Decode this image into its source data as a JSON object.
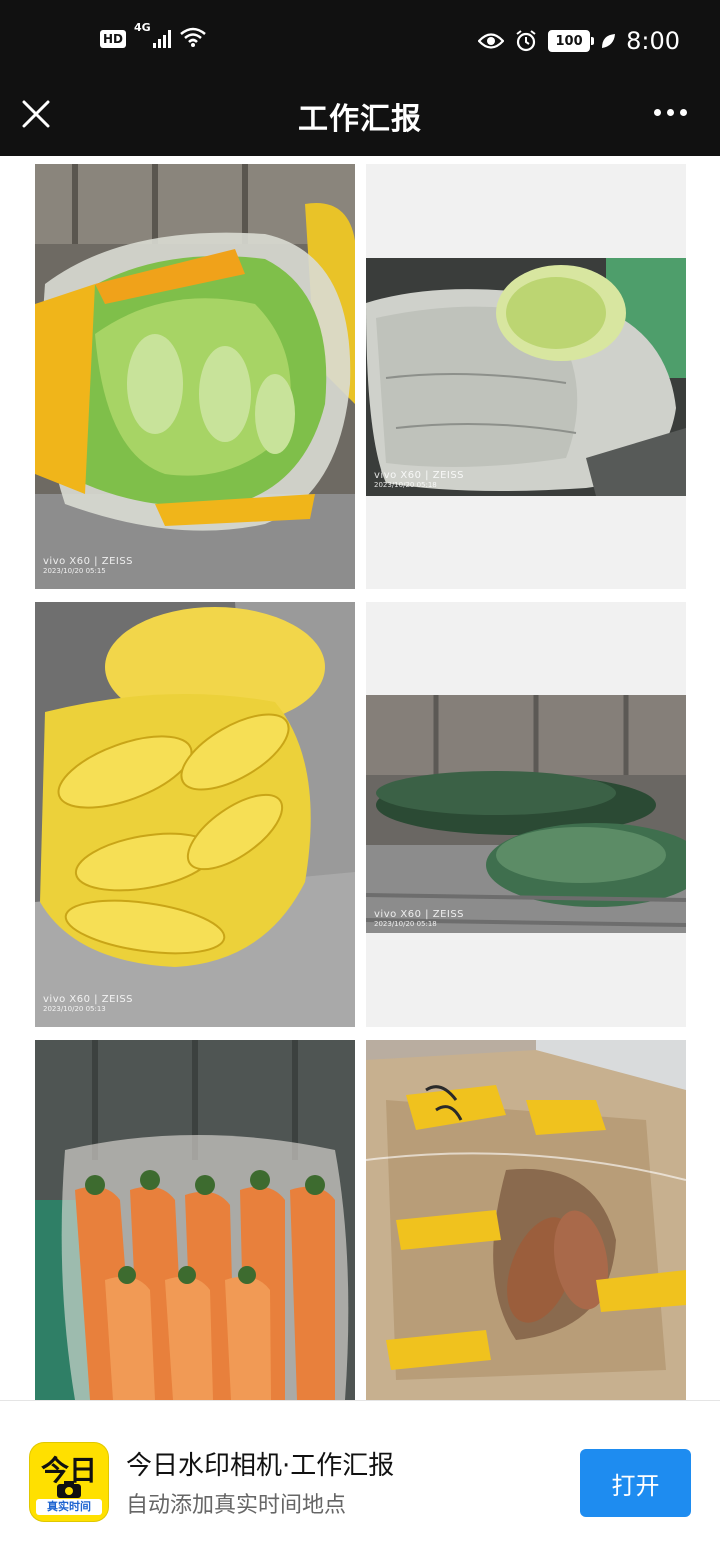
{
  "status_bar": {
    "hd_badge": "HD",
    "network": "4G",
    "battery": "100",
    "time": "8:00",
    "icons": [
      "signal-icon",
      "wifi-icon",
      "eye-icon",
      "alarm-icon",
      "battery-icon",
      "leaf-icon"
    ]
  },
  "title_bar": {
    "title": "工作汇报",
    "close_icon": "close-icon",
    "more_icon": "more-icon"
  },
  "photos": [
    {
      "subject": "napa cabbage",
      "watermark": "vivo X60 | ZEISS",
      "timestamp": "2023/10/20 05:15"
    },
    {
      "subject": "napa cabbage in bags",
      "watermark": "vivo X60 | ZEISS",
      "timestamp": "2023/10/20 05:18"
    },
    {
      "subject": "sweet corn",
      "watermark": "vivo X60 | ZEISS",
      "timestamp": "2023/10/20 05:13"
    },
    {
      "subject": "winter melon",
      "watermark": "vivo X60 | ZEISS",
      "timestamp": "2023/10/20 05:18"
    },
    {
      "subject": "carrots",
      "watermark": "",
      "timestamp": ""
    },
    {
      "subject": "sweet potatoes in box",
      "watermark": "",
      "timestamp": ""
    }
  ],
  "banner": {
    "app_icon_text": "今日",
    "app_icon_strip": "真实时间",
    "title": "今日水印相机·工作汇报",
    "subtitle": "自动添加真实时间地点",
    "open_button": "打开"
  },
  "colors": {
    "bar_background": "#111111",
    "open_button": "#1e8cf0",
    "app_icon": "#ffe000"
  }
}
